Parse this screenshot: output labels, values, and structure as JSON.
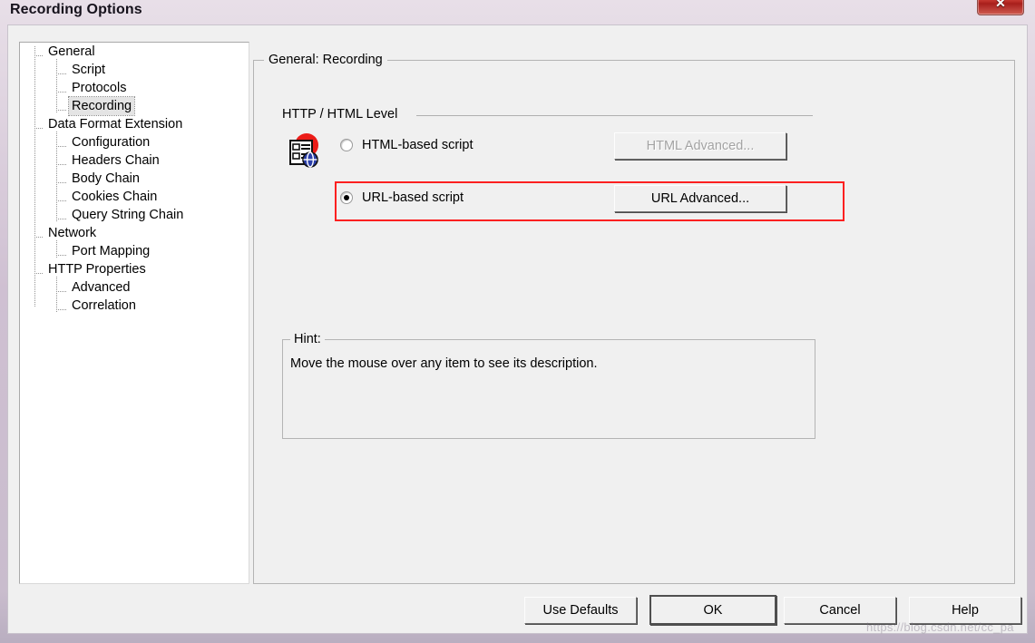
{
  "window": {
    "title": "Recording Options",
    "close_label": "✕"
  },
  "tree": {
    "items": [
      {
        "label": "General",
        "level": 0,
        "selected": false
      },
      {
        "label": "Script",
        "level": 1,
        "selected": false
      },
      {
        "label": "Protocols",
        "level": 1,
        "selected": false
      },
      {
        "label": "Recording",
        "level": 1,
        "selected": true
      },
      {
        "label": "Data Format Extension",
        "level": 0,
        "selected": false
      },
      {
        "label": "Configuration",
        "level": 1,
        "selected": false
      },
      {
        "label": "Headers Chain",
        "level": 1,
        "selected": false
      },
      {
        "label": "Body Chain",
        "level": 1,
        "selected": false
      },
      {
        "label": "Cookies Chain",
        "level": 1,
        "selected": false
      },
      {
        "label": "Query String Chain",
        "level": 1,
        "selected": false
      },
      {
        "label": "Network",
        "level": 0,
        "selected": false
      },
      {
        "label": "Port Mapping",
        "level": 1,
        "selected": false
      },
      {
        "label": "HTTP Properties",
        "level": 0,
        "selected": false
      },
      {
        "label": "Advanced",
        "level": 1,
        "selected": false
      },
      {
        "label": "Correlation",
        "level": 1,
        "selected": false
      }
    ]
  },
  "content": {
    "group_title": "General: Recording",
    "level_section": {
      "label": "HTTP / HTML Level",
      "icon": "recording-protocol-icon",
      "options": [
        {
          "label": "HTML-based script",
          "selected": false,
          "button_label": "HTML Advanced...",
          "button_enabled": false
        },
        {
          "label": "URL-based script",
          "selected": true,
          "button_label": "URL Advanced...",
          "button_enabled": true
        }
      ],
      "highlight_color": "#fc2020",
      "highlighted_option_index": 1
    },
    "hint": {
      "title": "Hint:",
      "text": "Move the mouse over any item to see its description."
    }
  },
  "footer": {
    "buttons": [
      {
        "label": "Use Defaults",
        "default": false
      },
      {
        "label": "OK",
        "default": true
      },
      {
        "label": "Cancel",
        "default": false
      },
      {
        "label": "Help",
        "default": false
      }
    ]
  },
  "watermark": {
    "text": "https://blog.csdn.net/cc_pa"
  },
  "colors": {
    "titlebar": "#cfc0d2",
    "dialog_face": "#f0f0f0",
    "tree_background": "#ffffff",
    "highlight": "#fc2020",
    "close_button": "#c0322c"
  }
}
